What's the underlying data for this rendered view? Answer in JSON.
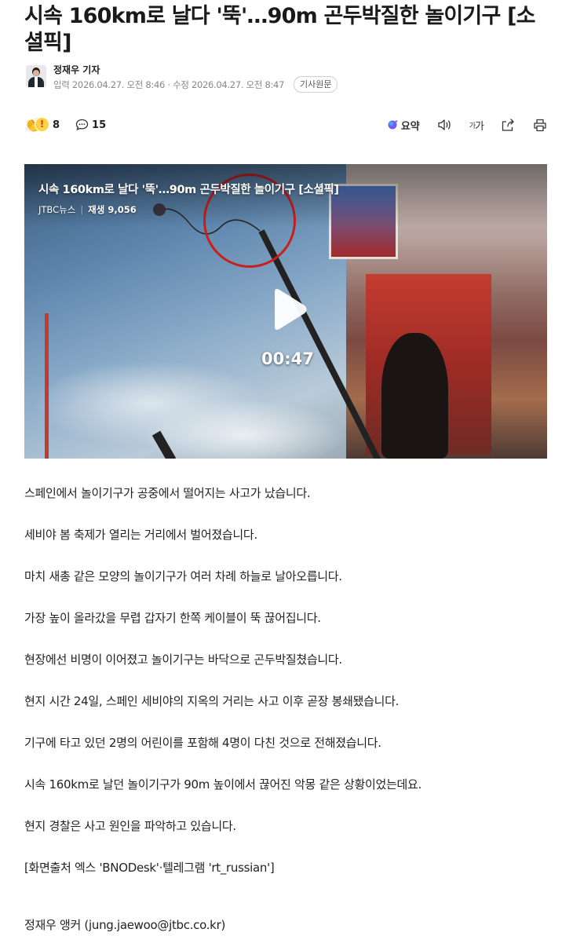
{
  "headline": "시속 160km로 날다 '뚝'…90m 곤두박질한 놀이기구 [소셜픽]",
  "reporter": {
    "name": "정재우 기자",
    "dates": "입력 2026.04.27. 오전 8:46 · 수정 2026.04.27. 오전 8:47",
    "original_article_label": "기사원문"
  },
  "engagement": {
    "reaction_count": "8",
    "comment_count": "15"
  },
  "toolbar": {
    "summary_label": "요약",
    "fontsize_label_small": "가",
    "fontsize_label_large": "가"
  },
  "video": {
    "title": "시속 160km로 날다 '뚝'…90m 곤두박질한 놀이기구 [소셜픽]",
    "channel": "JTBC뉴스",
    "views": "재생 9,056",
    "duration": "00:47"
  },
  "paragraphs": [
    "스페인에서 놀이기구가 공중에서 떨어지는 사고가 났습니다.",
    "세비야 봄 축제가 열리는 거리에서 벌어졌습니다.",
    "마치 새총 같은 모양의 놀이기구가 여러 차례 하늘로 날아오릅니다.",
    "가장 높이 올라갔을 무렵 갑자기 한쪽 케이블이 뚝 끊어집니다.",
    "현장에선 비명이 이어졌고 놀이기구는 바닥으로 곤두박질쳤습니다.",
    "현지 시간 24일, 스페인 세비야의 지옥의 거리는 사고 이후 곧장 봉쇄됐습니다.",
    "기구에 타고 있던 2명의 어린이를 포함해 4명이 다친 것으로 전해졌습니다.",
    "시속 160km로 날던 놀이기구가 90m 높이에서 끊어진 악몽 같은 상황이었는데요.",
    "현지 경찰은 사고 원인을 파악하고 있습니다.",
    "[화면출처 엑스 'BNODesk'·텔레그램 'rt_russian']"
  ],
  "byline": "정재우 앵커 (jung.jaewoo@jtbc.co.kr)"
}
